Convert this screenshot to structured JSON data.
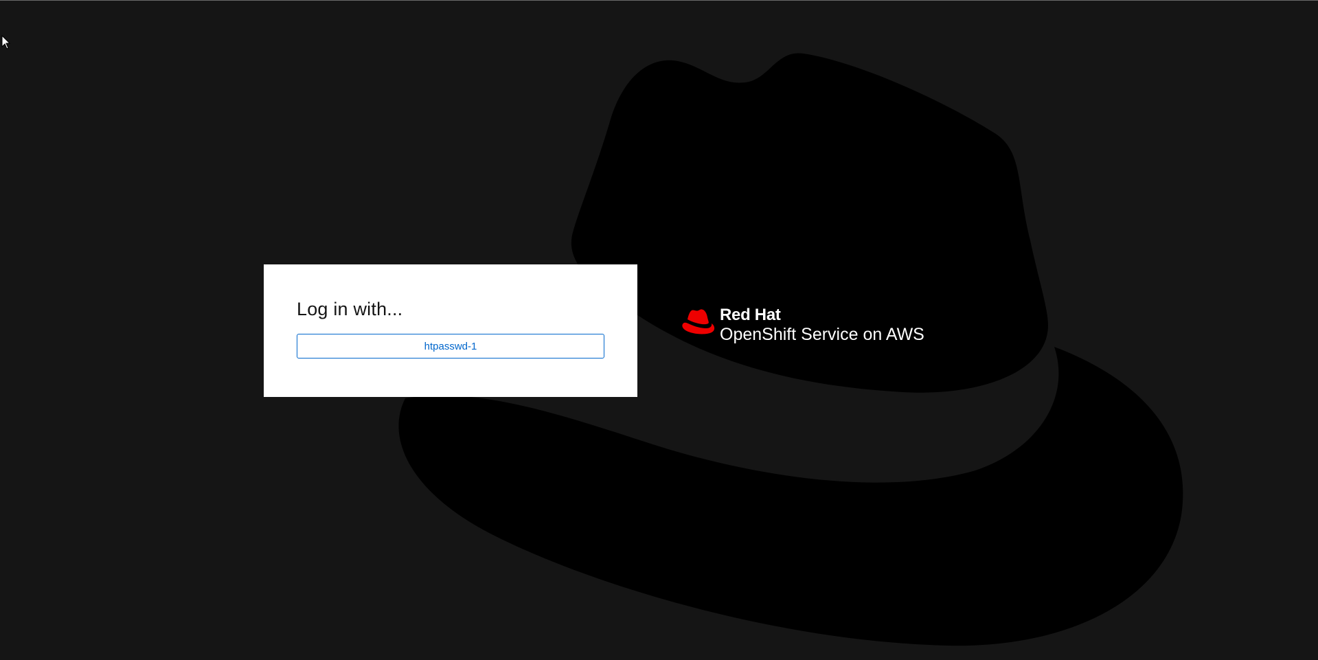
{
  "login": {
    "title": "Log in with...",
    "providers": [
      "htpasswd-1"
    ]
  },
  "brand": {
    "company": "Red Hat",
    "product_name": "OpenShift",
    "product_suffix": "Service on AWS"
  },
  "colors": {
    "background": "#151515",
    "hat_silhouette": "#000000",
    "card_background": "#ffffff",
    "link_blue": "#0066cc",
    "brand_red": "#ee0000"
  },
  "icons": {
    "logo": "redhat-fedora-icon",
    "pointer": "mouse-cursor-icon"
  }
}
